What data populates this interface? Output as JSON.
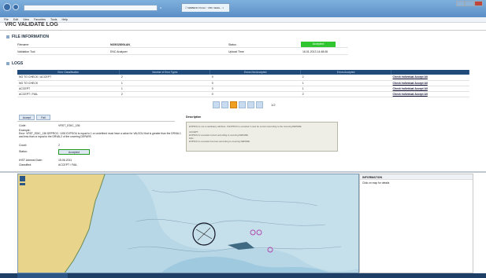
{
  "browser": {
    "tab_inactive": "H",
    "tab_active": "☐ WEBENC Portal :: VRC Valida... ×",
    "menu": [
      "File",
      "Edit",
      "View",
      "Favorites",
      "Tools",
      "Help"
    ]
  },
  "page": {
    "title": "VRC VALIDATE LOG",
    "file_info_header": "FILE INFORMATION",
    "file_info": {
      "filename_label": "Filename",
      "filename_value": "NO5G2800LAN_",
      "status_label": "Status",
      "status_value": "Accepted",
      "validation_tool_label": "Validation Tool",
      "validation_tool_value": "ENC Analyzer",
      "upload_time_label": "Upload Time",
      "upload_time_value": "16.01.2013 14:48:06"
    },
    "logs_header": "LOGS",
    "log_columns": [
      "Error Classification",
      "Number of Error Types",
      "Errors Not Accepted",
      "Errors Accepted"
    ],
    "log_rows": [
      {
        "cls": "NO TO CHECK / ACCEPT",
        "types": "2",
        "not_acc": "0",
        "acc": "2"
      },
      {
        "cls": "NO TO CHECK",
        "types": "1",
        "not_acc": "0",
        "acc": "1"
      },
      {
        "cls": "ACCEPT",
        "types": "1",
        "not_acc": "0",
        "acc": "1"
      },
      {
        "cls": "ACCEPT / FAIL",
        "types": "2",
        "not_acc": "0",
        "acc": "2"
      }
    ],
    "row_actions": {
      "individual": "Check Individual",
      "accept_all": "Accept All"
    },
    "pager_text": "1/2",
    "tabs": {
      "accept": "Accept",
      "fail": "Fail"
    },
    "description_label": "Description",
    "detail": {
      "code_label": "Code:",
      "code_value": "VRST_EDIC_136",
      "example_label": "Example:",
      "example_text": "Error: VRST_EDIC_136 DRPROC: 1000 EXPSOU is equal to 1 or undefined must have a value for VALSOU that is greater than the DRVAL1 and less than or equal to the DRVAL2 of the covering DEPARE.",
      "count_label": "Count:",
      "count_value": "2",
      "status_label": "Status:",
      "status_value": "Accepted",
      "admin_date_label": "IHST Admnst Date:",
      "admin_date_value": "15.06.2011",
      "classified_label": "Classified:",
      "classified_value": "ACCEPT / FAIL"
    },
    "description_text": [
      "EXPSOU is not a mandatory attribute. If EXPSOU is encoded it must be correct according to the covering DEPARE.",
      "",
      "ACCEPT:",
      "EXPSOU is encoded correct according to covering DEPARE.",
      "FAIL:",
      "EXPSOU is encoded incorrect according to covering DEPARE."
    ],
    "map_sidebar": {
      "header": "INFORMATION",
      "text": "Click on map for details"
    }
  },
  "colors": {
    "accent": "#1f4a7a",
    "accepted": "#2ec52e",
    "water": "#a9cfe0",
    "land": "#e8d48a"
  }
}
